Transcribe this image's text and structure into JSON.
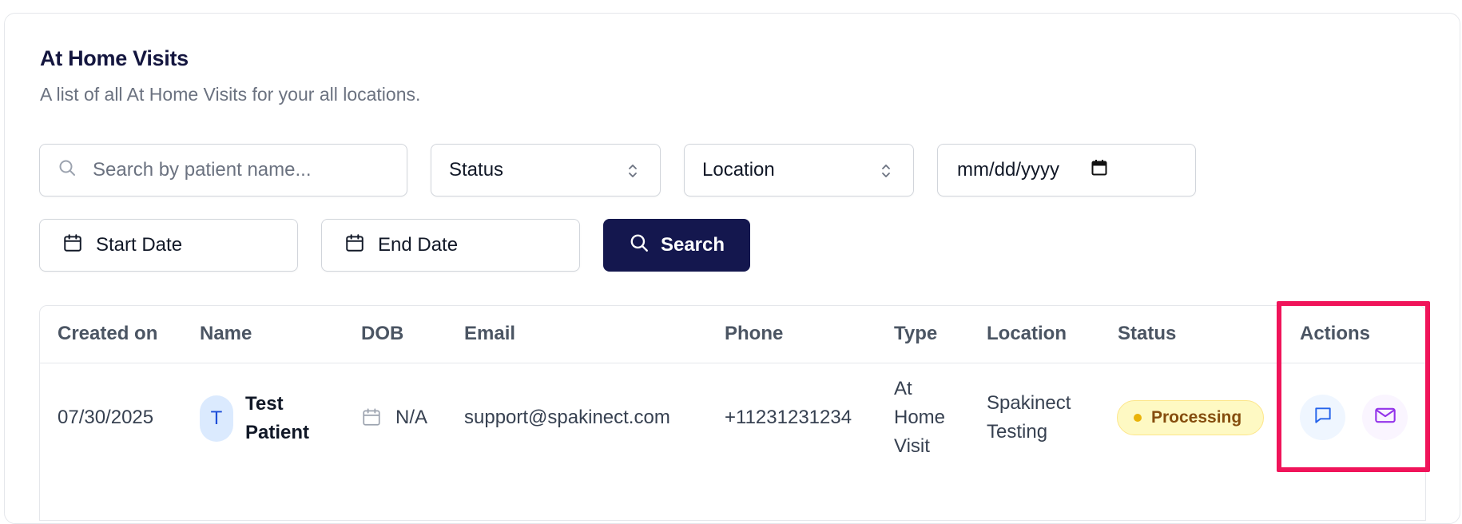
{
  "header": {
    "title": "At Home Visits",
    "subtitle": "A list of all At Home Visits for your all locations."
  },
  "filters": {
    "search_placeholder": "Search by patient name...",
    "status_label": "Status",
    "location_label": "Location",
    "date_placeholder": "mm/dd/yyyy",
    "start_date_label": "Start Date",
    "end_date_label": "End Date",
    "search_button": "Search"
  },
  "table": {
    "columns": [
      "Created on",
      "Name",
      "DOB",
      "Email",
      "Phone",
      "Type",
      "Location",
      "Status",
      "Actions"
    ],
    "rows": [
      {
        "created_on": "07/30/2025",
        "avatar_initial": "T",
        "name_line1": "Test",
        "name_line2": "Patient",
        "dob": "N/A",
        "email": "support@spakinect.com",
        "phone": "+11231231234",
        "type_line1": "At",
        "type_line2": "Home",
        "type_line3": "Visit",
        "location_line1": "Spakinect",
        "location_line2": "Testing",
        "status": "Processing"
      }
    ]
  },
  "colors": {
    "brand_navy": "#14174e",
    "highlight": "#f0145a",
    "status_processing_bg": "#fef9c3",
    "status_processing_text": "#854d0e"
  },
  "icons": {
    "search": "search-icon",
    "chevron": "chevron-up-down-icon",
    "calendar": "calendar-icon",
    "message": "chat-bubble-icon",
    "mail": "mail-icon"
  }
}
